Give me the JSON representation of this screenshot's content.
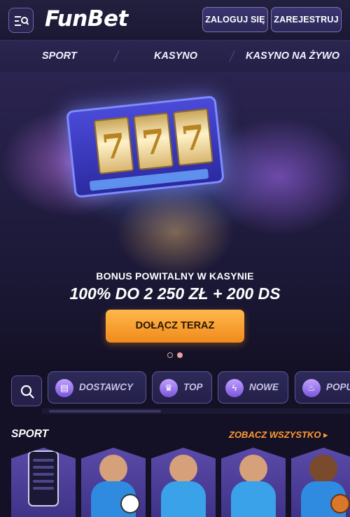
{
  "header": {
    "logo": "FunBet",
    "login_label": "ZALOGUJ SIĘ",
    "register_label": "ZAREJESTRUJ"
  },
  "nav": {
    "items": [
      "SPORT",
      "KASYNO",
      "KASYNO NA ŻYWO"
    ]
  },
  "hero": {
    "reel_symbols": [
      "7",
      "7",
      "7"
    ],
    "subtitle": "BONUS POWITALNY W KASYNIE",
    "title": "100% DO 2 250 ZŁ + 200 DS",
    "cta_label": "DOŁĄCZ TERAZ",
    "slides_total": 2,
    "active_slide": 2
  },
  "filters": {
    "chips": [
      {
        "label": "DOSTAWCY",
        "icon": "book-icon"
      },
      {
        "label": "TOP",
        "icon": "crown-icon"
      },
      {
        "label": "NOWE",
        "icon": "lightning-icon"
      },
      {
        "label": "POPU",
        "icon": "flame-icon"
      }
    ]
  },
  "sport_section": {
    "title": "SPORT",
    "see_all_label": "ZOBACZ WSZYSTKO ▸",
    "cards": [
      "mobile-app",
      "football-player",
      "tennis-player",
      "table-tennis-player",
      "basketball-player"
    ]
  },
  "colors": {
    "background": "#141126",
    "accent": "#ff9a2e",
    "cta": "#f5a037",
    "chip_border": "#5d5794"
  }
}
